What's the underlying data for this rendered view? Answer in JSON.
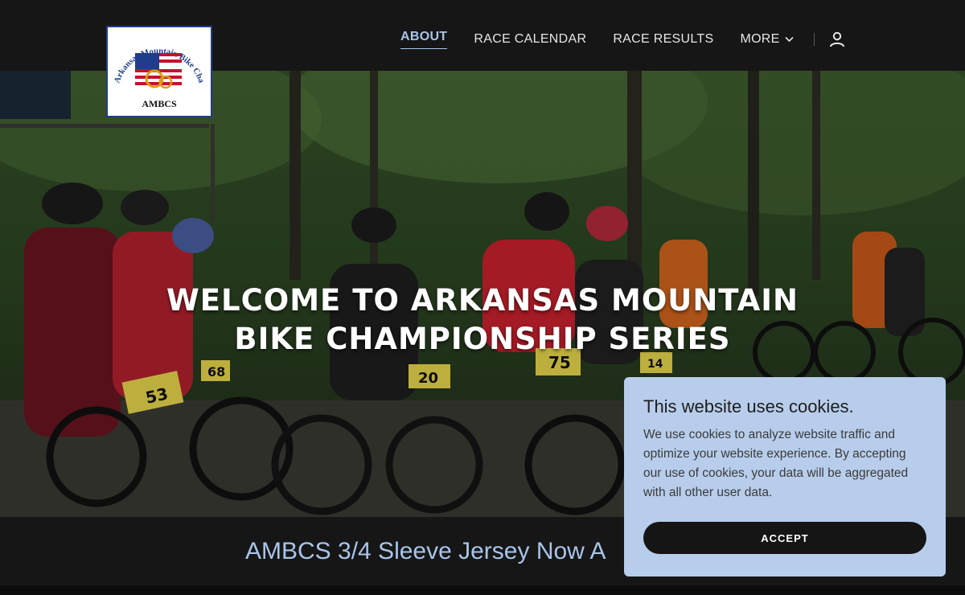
{
  "logo": {
    "abbr": "AMBCS",
    "text": "Arkansas Mountain Bike Championship Series"
  },
  "nav": {
    "items": [
      {
        "label": "ABOUT",
        "active": true
      },
      {
        "label": "RACE CALENDAR",
        "active": false
      },
      {
        "label": "RACE RESULTS",
        "active": false
      }
    ],
    "more_label": "MORE",
    "icons": {
      "more": "chevron-down-icon",
      "account": "user-icon"
    }
  },
  "hero": {
    "title_line1": "WELCOME TO ARKANSAS MOUNTAIN",
    "title_line2": "BIKE CHAMPIONSHIP SERIES",
    "bib_numbers": [
      "53",
      "68",
      "20",
      "75",
      "14"
    ]
  },
  "banner": {
    "text": "AMBCS 3/4 Sleeve Jersey Now A"
  },
  "cookie": {
    "title": "This website uses cookies.",
    "body": "We use cookies to analyze website traffic and optimize your website experience. By accepting our use of cookies, your data will be aggregated with all other user data.",
    "accept_label": "ACCEPT"
  },
  "colors": {
    "accent": "#a9c4ea",
    "header_bg": "#161616",
    "cookie_bg": "#b7cdeb"
  }
}
